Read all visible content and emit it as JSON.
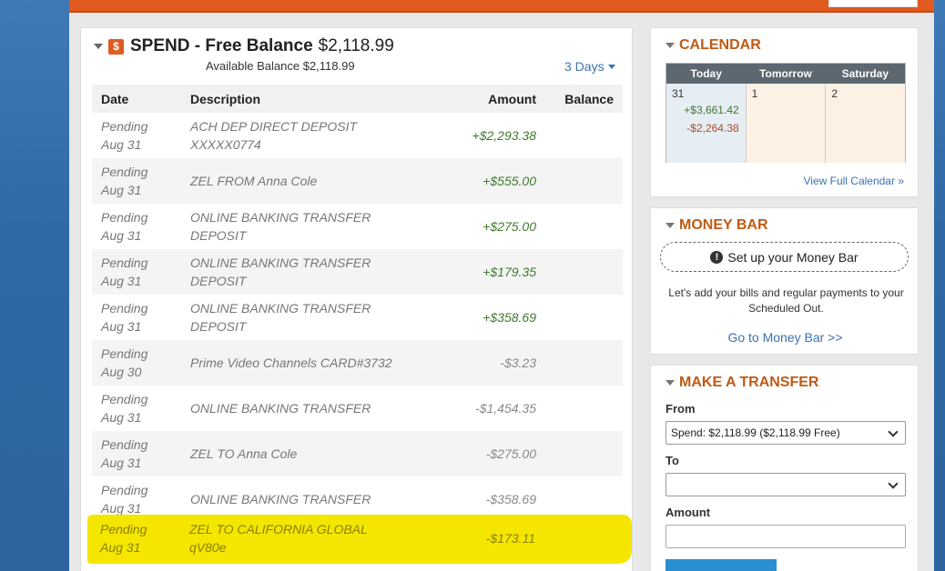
{
  "spend": {
    "title": "SPEND - Free Balance",
    "balance": "$2,118.99",
    "available": "Available Balance $2,118.99",
    "range_label": "3 Days",
    "columns": {
      "date": "Date",
      "description": "Description",
      "amount": "Amount",
      "balance": "Balance"
    },
    "transactions": [
      {
        "status": "Pending",
        "date": "Aug 31",
        "desc1": "ACH DEP DIRECT DEPOSIT",
        "desc2": "XXXXX0774",
        "amount": "+$2,293.38",
        "sign": "pos"
      },
      {
        "status": "Pending",
        "date": "Aug 31",
        "desc1": "ZEL FROM Anna Cole",
        "desc2": "",
        "amount": "+$555.00",
        "sign": "pos"
      },
      {
        "status": "Pending",
        "date": "Aug 31",
        "desc1": "ONLINE BANKING TRANSFER",
        "desc2": "DEPOSIT",
        "amount": "+$275.00",
        "sign": "pos"
      },
      {
        "status": "Pending",
        "date": "Aug 31",
        "desc1": "ONLINE BANKING TRANSFER",
        "desc2": "DEPOSIT",
        "amount": "+$179.35",
        "sign": "pos"
      },
      {
        "status": "Pending",
        "date": "Aug 31",
        "desc1": "ONLINE BANKING TRANSFER",
        "desc2": "DEPOSIT",
        "amount": "+$358.69",
        "sign": "pos"
      },
      {
        "status": "Pending",
        "date": "Aug 30",
        "desc1": "Prime Video Channels CARD#3732",
        "desc2": "",
        "amount": "-$3.23",
        "sign": "neg"
      },
      {
        "status": "Pending",
        "date": "Aug 31",
        "desc1": "ONLINE BANKING TRANSFER",
        "desc2": "",
        "amount": "-$1,454.35",
        "sign": "neg"
      },
      {
        "status": "Pending",
        "date": "Aug 31",
        "desc1": "ZEL TO Anna Cole",
        "desc2": "",
        "amount": "-$275.00",
        "sign": "neg"
      },
      {
        "status": "Pending",
        "date": "Aug 31",
        "desc1": "ONLINE BANKING TRANSFER",
        "desc2": "",
        "amount": "-$358.69",
        "sign": "neg"
      },
      {
        "status": "Pending",
        "date": "Aug 31",
        "desc1": "ZEL TO CALIFORNIA GLOBAL",
        "desc2": "qV80e",
        "amount": "-$173.11",
        "sign": "neg"
      }
    ]
  },
  "calendar": {
    "title": "CALENDAR",
    "headers": [
      "Today",
      "Tomorrow",
      "Saturday"
    ],
    "days": [
      {
        "num": "31",
        "plus": "+$3,661.42",
        "minus": "-$2,264.38"
      },
      {
        "num": "1",
        "plus": "",
        "minus": ""
      },
      {
        "num": "2",
        "plus": "",
        "minus": ""
      }
    ],
    "view_link": "View Full Calendar »"
  },
  "money_bar": {
    "title": "MONEY BAR",
    "setup_label": "Set up your Money Bar",
    "description": "Let's add your bills and regular payments to your Scheduled Out.",
    "link": "Go to Money Bar >>"
  },
  "transfer": {
    "title": "MAKE A TRANSFER",
    "from_label": "From",
    "from_value": "Spend: $2,118.99 ($2,118.99 Free)",
    "to_label": "To",
    "to_value": "",
    "amount_label": "Amount"
  },
  "colors": {
    "accent_orange": "#e15a20",
    "link_blue": "#3a72b0",
    "positive_green": "#3f7a2e",
    "highlight_yellow": "#f5e600"
  }
}
